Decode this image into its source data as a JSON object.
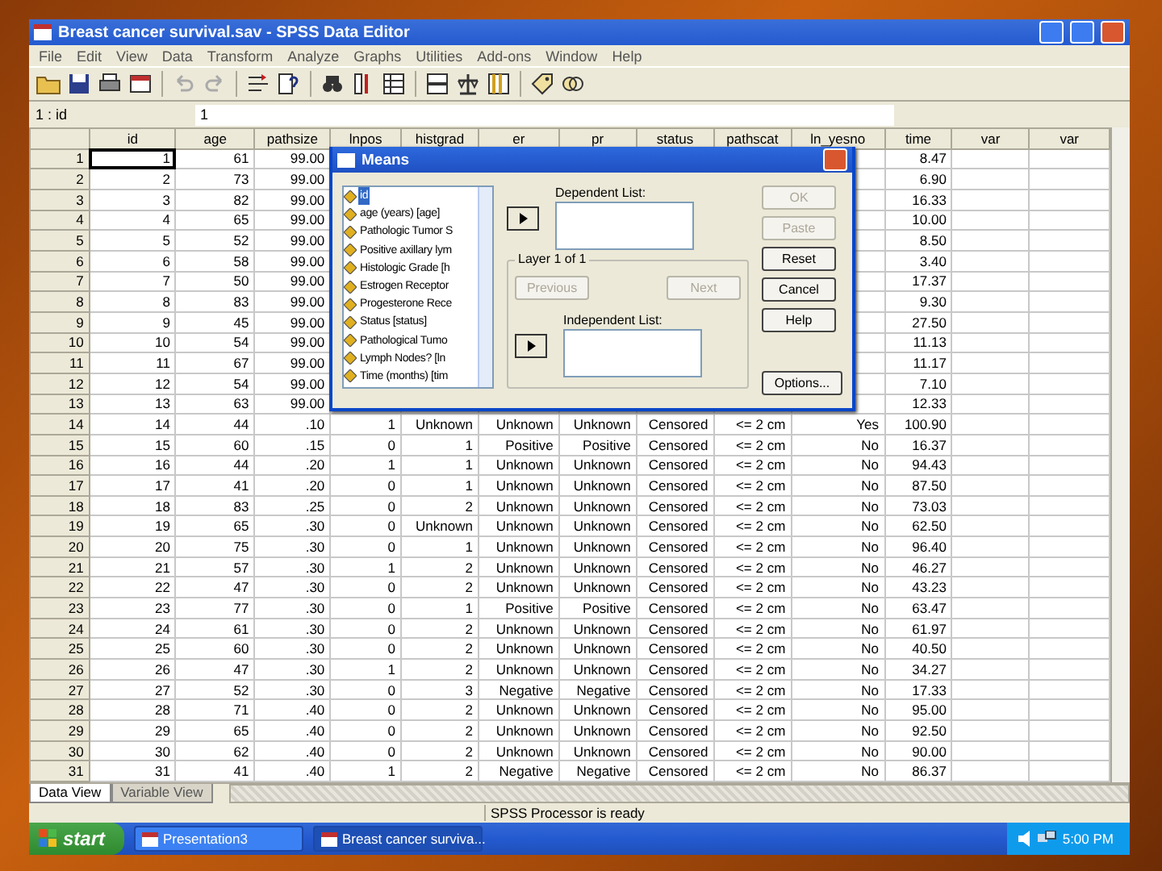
{
  "window": {
    "title": "Breast cancer survival.sav - SPSS Data Editor"
  },
  "menu": [
    "File",
    "Edit",
    "View",
    "Data",
    "Transform",
    "Analyze",
    "Graphs",
    "Utilities",
    "Add-ons",
    "Window",
    "Help"
  ],
  "cell_editor": {
    "address": "1 : id",
    "value": "1"
  },
  "table": {
    "columns": [
      "id",
      "age",
      "pathsize",
      "lnpos",
      "histgrad",
      "er",
      "pr",
      "status",
      "pathscat",
      "ln_yesno",
      "time",
      "var",
      "var"
    ],
    "rows": [
      {
        "number": "1",
        "id": "1",
        "age": "61",
        "pathsize": "99.00",
        "time": "8.47"
      },
      {
        "number": "2",
        "id": "2",
        "age": "73",
        "pathsize": "99.00",
        "time": "6.90"
      },
      {
        "number": "3",
        "id": "3",
        "age": "82",
        "pathsize": "99.00",
        "time": "16.33"
      },
      {
        "number": "4",
        "id": "4",
        "age": "65",
        "pathsize": "99.00",
        "time": "10.00"
      },
      {
        "number": "5",
        "id": "5",
        "age": "52",
        "pathsize": "99.00",
        "time": "8.50"
      },
      {
        "number": "6",
        "id": "6",
        "age": "58",
        "pathsize": "99.00",
        "time": "3.40"
      },
      {
        "number": "7",
        "id": "7",
        "age": "50",
        "pathsize": "99.00",
        "time": "17.37"
      },
      {
        "number": "8",
        "id": "8",
        "age": "83",
        "pathsize": "99.00",
        "time": "9.30"
      },
      {
        "number": "9",
        "id": "9",
        "age": "45",
        "pathsize": "99.00",
        "time": "27.50"
      },
      {
        "number": "10",
        "id": "10",
        "age": "54",
        "pathsize": "99.00",
        "time": "11.13"
      },
      {
        "number": "11",
        "id": "11",
        "age": "67",
        "pathsize": "99.00",
        "time": "11.17"
      },
      {
        "number": "12",
        "id": "12",
        "age": "54",
        "pathsize": "99.00",
        "time": "7.10"
      },
      {
        "number": "13",
        "id": "13",
        "age": "63",
        "pathsize": "99.00",
        "time": "12.33"
      },
      {
        "number": "14",
        "id": "14",
        "age": "44",
        "pathsize": ".10",
        "lnpos": "1",
        "histgrad": "Unknown",
        "er": "Unknown",
        "pr": "Unknown",
        "status": "Censored",
        "pathscat": "<= 2 cm",
        "ln_yesno": "Yes",
        "time": "100.90"
      },
      {
        "number": "15",
        "id": "15",
        "age": "60",
        "pathsize": ".15",
        "lnpos": "0",
        "histgrad": "1",
        "er": "Positive",
        "pr": "Positive",
        "status": "Censored",
        "pathscat": "<= 2 cm",
        "ln_yesno": "No",
        "time": "16.37"
      },
      {
        "number": "16",
        "id": "16",
        "age": "44",
        "pathsize": ".20",
        "lnpos": "1",
        "histgrad": "1",
        "er": "Unknown",
        "pr": "Unknown",
        "status": "Censored",
        "pathscat": "<= 2 cm",
        "ln_yesno": "No",
        "time": "94.43"
      },
      {
        "number": "17",
        "id": "17",
        "age": "41",
        "pathsize": ".20",
        "lnpos": "0",
        "histgrad": "1",
        "er": "Unknown",
        "pr": "Unknown",
        "status": "Censored",
        "pathscat": "<= 2 cm",
        "ln_yesno": "No",
        "time": "87.50"
      },
      {
        "number": "18",
        "id": "18",
        "age": "83",
        "pathsize": ".25",
        "lnpos": "0",
        "histgrad": "2",
        "er": "Unknown",
        "pr": "Unknown",
        "status": "Censored",
        "pathscat": "<= 2 cm",
        "ln_yesno": "No",
        "time": "73.03"
      },
      {
        "number": "19",
        "id": "19",
        "age": "65",
        "pathsize": ".30",
        "lnpos": "0",
        "histgrad": "Unknown",
        "er": "Unknown",
        "pr": "Unknown",
        "status": "Censored",
        "pathscat": "<= 2 cm",
        "ln_yesno": "No",
        "time": "62.50"
      },
      {
        "number": "20",
        "id": "20",
        "age": "75",
        "pathsize": ".30",
        "lnpos": "0",
        "histgrad": "1",
        "er": "Unknown",
        "pr": "Unknown",
        "status": "Censored",
        "pathscat": "<= 2 cm",
        "ln_yesno": "No",
        "time": "96.40"
      },
      {
        "number": "21",
        "id": "21",
        "age": "57",
        "pathsize": ".30",
        "lnpos": "1",
        "histgrad": "2",
        "er": "Unknown",
        "pr": "Unknown",
        "status": "Censored",
        "pathscat": "<= 2 cm",
        "ln_yesno": "No",
        "time": "46.27"
      },
      {
        "number": "22",
        "id": "22",
        "age": "47",
        "pathsize": ".30",
        "lnpos": "0",
        "histgrad": "2",
        "er": "Unknown",
        "pr": "Unknown",
        "status": "Censored",
        "pathscat": "<= 2 cm",
        "ln_yesno": "No",
        "time": "43.23"
      },
      {
        "number": "23",
        "id": "23",
        "age": "77",
        "pathsize": ".30",
        "lnpos": "0",
        "histgrad": "1",
        "er": "Positive",
        "pr": "Positive",
        "status": "Censored",
        "pathscat": "<= 2 cm",
        "ln_yesno": "No",
        "time": "63.47"
      },
      {
        "number": "24",
        "id": "24",
        "age": "61",
        "pathsize": ".30",
        "lnpos": "0",
        "histgrad": "2",
        "er": "Unknown",
        "pr": "Unknown",
        "status": "Censored",
        "pathscat": "<= 2 cm",
        "ln_yesno": "No",
        "time": "61.97"
      },
      {
        "number": "25",
        "id": "25",
        "age": "60",
        "pathsize": ".30",
        "lnpos": "0",
        "histgrad": "2",
        "er": "Unknown",
        "pr": "Unknown",
        "status": "Censored",
        "pathscat": "<= 2 cm",
        "ln_yesno": "No",
        "time": "40.50"
      },
      {
        "number": "26",
        "id": "26",
        "age": "47",
        "pathsize": ".30",
        "lnpos": "1",
        "histgrad": "2",
        "er": "Unknown",
        "pr": "Unknown",
        "status": "Censored",
        "pathscat": "<= 2 cm",
        "ln_yesno": "No",
        "time": "34.27"
      },
      {
        "number": "27",
        "id": "27",
        "age": "52",
        "pathsize": ".30",
        "lnpos": "0",
        "histgrad": "3",
        "er": "Negative",
        "pr": "Negative",
        "status": "Censored",
        "pathscat": "<= 2 cm",
        "ln_yesno": "No",
        "time": "17.33"
      },
      {
        "number": "28",
        "id": "28",
        "age": "71",
        "pathsize": ".40",
        "lnpos": "0",
        "histgrad": "2",
        "er": "Unknown",
        "pr": "Unknown",
        "status": "Censored",
        "pathscat": "<= 2 cm",
        "ln_yesno": "No",
        "time": "95.00"
      },
      {
        "number": "29",
        "id": "29",
        "age": "65",
        "pathsize": ".40",
        "lnpos": "0",
        "histgrad": "2",
        "er": "Unknown",
        "pr": "Unknown",
        "status": "Censored",
        "pathscat": "<= 2 cm",
        "ln_yesno": "No",
        "time": "92.50"
      },
      {
        "number": "30",
        "id": "30",
        "age": "62",
        "pathsize": ".40",
        "lnpos": "0",
        "histgrad": "2",
        "er": "Unknown",
        "pr": "Unknown",
        "status": "Censored",
        "pathscat": "<= 2 cm",
        "ln_yesno": "No",
        "time": "90.00"
      },
      {
        "number": "31",
        "id": "31",
        "age": "41",
        "pathsize": ".40",
        "lnpos": "1",
        "histgrad": "2",
        "er": "Negative",
        "pr": "Negative",
        "status": "Censored",
        "pathscat": "<= 2 cm",
        "ln_yesno": "No",
        "time": "86.37"
      }
    ]
  },
  "sheet_tabs": [
    {
      "label": "Data View",
      "selected": true
    },
    {
      "label": "Variable View",
      "selected": false
    }
  ],
  "status_bar": "SPSS Processor is ready",
  "dialog": {
    "title": "Means",
    "variables": [
      {
        "label": "id",
        "selected": true
      },
      {
        "label": "age (years) [age]",
        "selected": false
      },
      {
        "label": "Pathologic Tumor S",
        "selected": false
      },
      {
        "label": "Positive axillary lym",
        "selected": false
      },
      {
        "label": "Histologic Grade [h",
        "selected": false
      },
      {
        "label": "Estrogen Receptor",
        "selected": false
      },
      {
        "label": "Progesterone Rece",
        "selected": false
      },
      {
        "label": "Status [status]",
        "selected": false
      },
      {
        "label": "Pathological Tumo",
        "selected": false
      },
      {
        "label": "Lymph Nodes? [ln",
        "selected": false
      },
      {
        "label": "Time (months) [tim",
        "selected": false
      }
    ],
    "dependent_label": "Dependent List:",
    "layer_label": "Layer 1 of 1",
    "layer_buttons": [
      {
        "label": "Previous",
        "disabled": true
      },
      {
        "label": "Next",
        "disabled": true
      }
    ],
    "independent_label": "Independent List:",
    "buttons": [
      {
        "label": "OK",
        "disabled": true
      },
      {
        "label": "Paste",
        "disabled": true
      },
      {
        "label": "Reset",
        "disabled": false
      },
      {
        "label": "Cancel",
        "disabled": false
      },
      {
        "label": "Help",
        "disabled": false
      }
    ],
    "options_button": "Options..."
  },
  "taskbar": {
    "start": "start",
    "tasks": [
      {
        "label": "Presentation3",
        "selected": false
      },
      {
        "label": "Breast cancer surviva...",
        "selected": true
      }
    ],
    "clock": "5:00 PM"
  }
}
